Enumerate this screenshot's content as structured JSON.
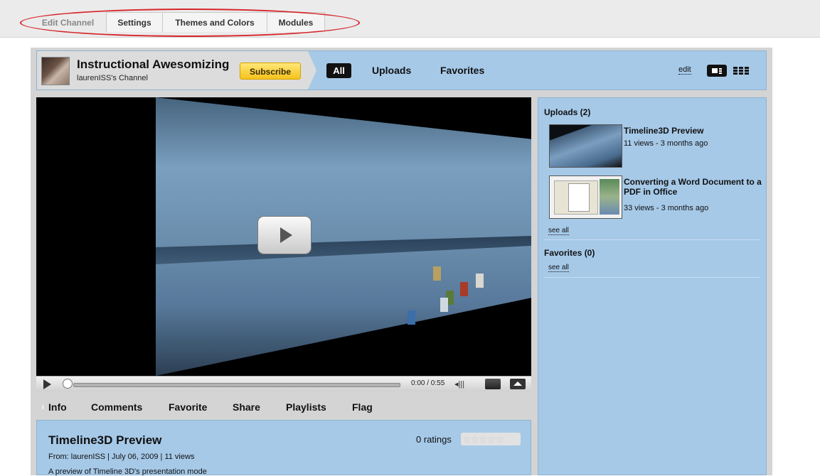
{
  "tabs": [
    "Edit Channel",
    "Settings",
    "Themes and Colors",
    "Modules"
  ],
  "channel": {
    "title": "Instructional Awesomizing",
    "subtitle": "laurenISS's Channel",
    "subscribe_label": "Subscribe",
    "nav": [
      "All",
      "Uploads",
      "Favorites"
    ],
    "edit_label": "edit"
  },
  "player": {
    "time": "0:00 / 0:55",
    "progress": 0
  },
  "video_tabs": [
    "Info",
    "Comments",
    "Favorite",
    "Share",
    "Playlists",
    "Flag"
  ],
  "video": {
    "title": "Timeline3D Preview",
    "meta": "From: laurenISS | July 06, 2009 | 11 views",
    "description": "A preview of Timeline 3D's presentation mode",
    "ratings": "0 ratings",
    "stars": "☆☆☆☆☆"
  },
  "sidebar": {
    "uploads_heading": "Uploads (2)",
    "uploads": [
      {
        "title": "Timeline3D Preview",
        "meta": "11 views - 3 months ago"
      },
      {
        "title": "Converting a Word Document to a PDF in Office",
        "meta": "33 views - 3 months ago"
      }
    ],
    "favorites_heading": "Favorites (0)",
    "see_all": "see all"
  },
  "colors": {
    "panel_blue": "#a6c9e8",
    "annotation_red": "#d6262b",
    "subscribe_yellow": "#f6c21c"
  }
}
